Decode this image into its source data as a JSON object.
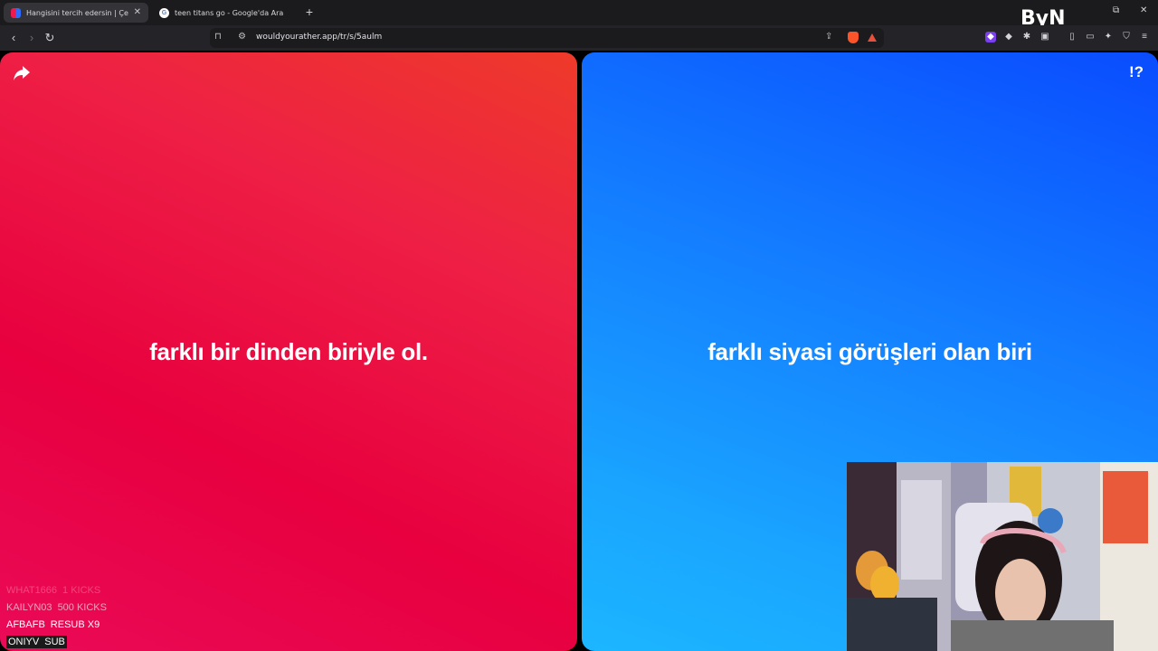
{
  "tabs": [
    {
      "title": "Hangisini tercih edersin | Çevrimiçi",
      "active": true
    },
    {
      "title": "teen titans go - Google'da Ara",
      "active": false
    }
  ],
  "browser": {
    "url": "wouldyourather.app/tr/s/5aulm",
    "overlay_logo": "ByN"
  },
  "options": {
    "left": {
      "text": "farklı bir dinden biriyle ol.",
      "color": "#ee1f45"
    },
    "right": {
      "text": "farklı siyasi görüşleri olan biri",
      "color": "#137bff"
    }
  },
  "help_label": "!?",
  "events": [
    {
      "name": "WHAT1666",
      "detail": "1 KICKS"
    },
    {
      "name": "KAILYN03",
      "detail": "500 KICKS"
    },
    {
      "name": "AFBAFB",
      "detail": "RESUB X9"
    },
    {
      "name": "ONIYV",
      "detail": "SUB"
    }
  ],
  "icons": [
    "back-icon",
    "forward-icon",
    "reload-icon",
    "bookmark-icon",
    "site-info-icon",
    "share-page-icon",
    "brave-shield-icon",
    "rewards-icon",
    "extensions-icon",
    "sidebar-icon",
    "wallet-icon",
    "leo-icon",
    "vpn-icon",
    "menu-icon",
    "share-icon"
  ]
}
